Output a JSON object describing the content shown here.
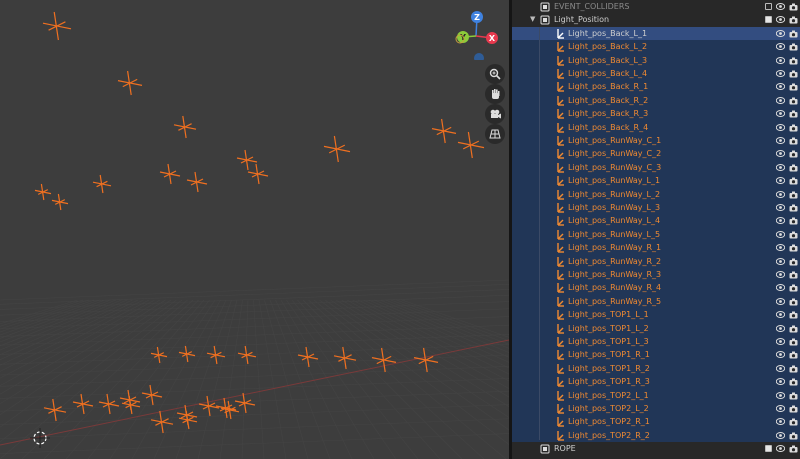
{
  "outliner": {
    "top_item": "EVENT_COLLIDERS",
    "collection": "Light_Position",
    "lights": [
      "Light_pos_Back_L_1",
      "Light_pos_Back_L_2",
      "Light_pos_Back_L_3",
      "Light_pos_Back_L_4",
      "Light_pos_Back_R_1",
      "Light_pos_Back_R_2",
      "Light_pos_Back_R_3",
      "Light_pos_Back_R_4",
      "Light_pos_RunWay_C_1",
      "Light_pos_RunWay_C_2",
      "Light_pos_RunWay_C_3",
      "Light_pos_RunWay_L_1",
      "Light_pos_RunWay_L_2",
      "Light_pos_RunWay_L_3",
      "Light_pos_RunWay_L_4",
      "Light_pos_RunWay_L_5",
      "Light_pos_RunWay_R_1",
      "Light_pos_RunWay_R_2",
      "Light_pos_RunWay_R_3",
      "Light_pos_RunWay_R_4",
      "Light_pos_RunWay_R_5",
      "Light_pos_TOP1_L_1",
      "Light_pos_TOP1_L_2",
      "Light_pos_TOP1_L_3",
      "Light_pos_TOP1_R_1",
      "Light_pos_TOP1_R_2",
      "Light_pos_TOP1_R_3",
      "Light_pos_TOP2_L_1",
      "Light_pos_TOP2_L_2",
      "Light_pos_TOP2_R_1",
      "Light_pos_TOP2_R_2"
    ],
    "bottom_item": "ROPE"
  },
  "gizmo": {
    "axis_z": "Z",
    "axis_y": "Y",
    "axis_x": "X",
    "colors": {
      "x": "#e8394e",
      "y": "#8ccb3a",
      "z": "#3f82e0"
    }
  },
  "icons": {
    "zoom": "zoom-icon",
    "pan": "hand-icon",
    "camera": "camera-view-icon",
    "ortho": "grid-icon"
  },
  "colors": {
    "empty_orange": "#f07020",
    "selection_blue": "#334d80",
    "outliner_bg": "#282828",
    "viewport_bg": "#3d3d3d"
  }
}
